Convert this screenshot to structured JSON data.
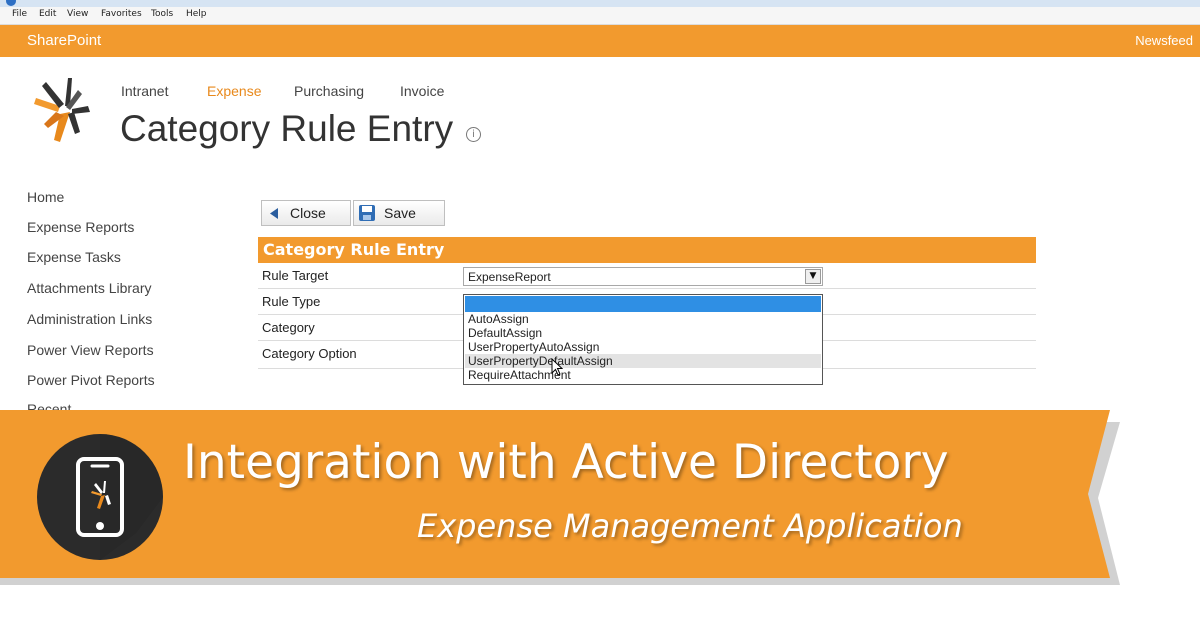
{
  "browser": {
    "menu": [
      "File",
      "Edit",
      "View",
      "Favorites",
      "Tools",
      "Help"
    ]
  },
  "suitebar": {
    "brand": "SharePoint",
    "newsfeed": "Newsfeed",
    "color": "#f29a2e"
  },
  "topnav": {
    "items": [
      "Intranet",
      "Expense",
      "Purchasing",
      "Invoice"
    ],
    "active": "Expense"
  },
  "page": {
    "title": "Category Rule Entry",
    "info_icon": "info-circle-icon"
  },
  "leftnav": {
    "items": [
      "Home",
      "Expense Reports",
      "Expense Tasks",
      "Attachments Library",
      "Administration Links",
      "Power View Reports",
      "Power Pivot Reports",
      "Recent"
    ]
  },
  "toolbar": {
    "close_label": "Close",
    "save_label": "Save"
  },
  "form": {
    "header": "Category Rule Entry",
    "rows": [
      "Rule Target",
      "Rule Type",
      "Category",
      "Category Option"
    ],
    "rule_target_value": "ExpenseReport",
    "rule_type_options": [
      "",
      "AutoAssign",
      "DefaultAssign",
      "UserPropertyAutoAssign",
      "UserPropertyDefaultAssign",
      "RequireAttachment"
    ],
    "highlighted_option": "UserPropertyDefaultAssign"
  },
  "banner": {
    "title": "Integration with Active Directory",
    "subtitle": "Expense Management Application",
    "color": "#f29a2e"
  }
}
